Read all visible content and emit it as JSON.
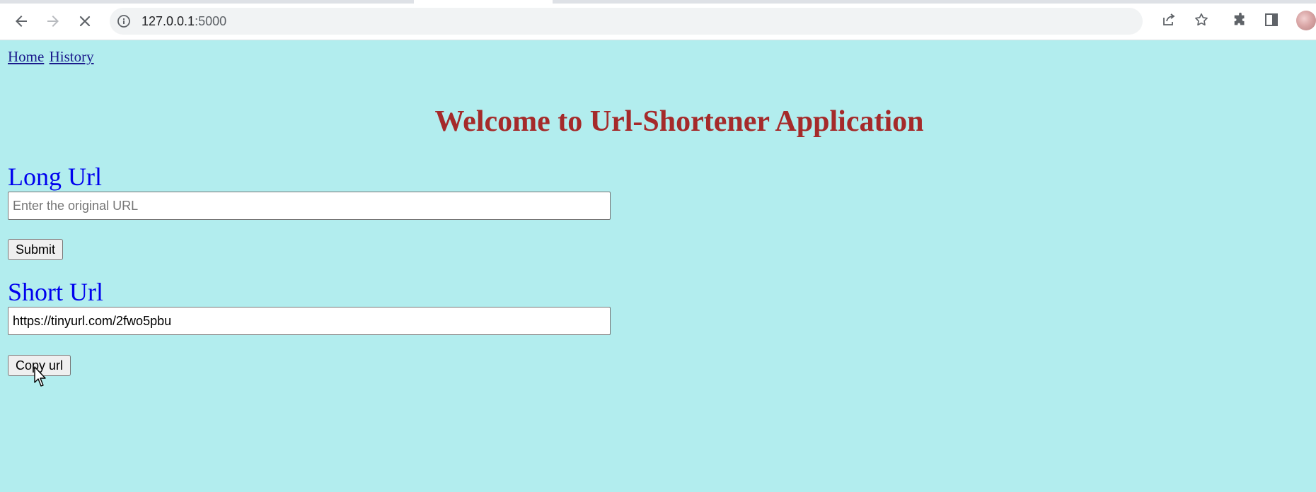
{
  "browser": {
    "url_host": "127.0.0.1",
    "url_port": ":5000"
  },
  "nav": {
    "home": "Home",
    "history": "History"
  },
  "heading": "Welcome to Url-Shortener Application",
  "long_url": {
    "label": "Long Url",
    "placeholder": "Enter the original URL",
    "value": ""
  },
  "submit_label": "Submit",
  "short_url": {
    "label": "Short Url",
    "value": "https://tinyurl.com/2fwo5pbu"
  },
  "copy_label": "Copy url",
  "colors": {
    "background": "#b2edee",
    "heading": "#a52a2a",
    "label": "#0000ee",
    "link": "#1a1a8c"
  },
  "icons": [
    "back-arrow-icon",
    "forward-arrow-icon",
    "stop-loading-icon",
    "info-icon",
    "share-icon",
    "star-icon",
    "extensions-puzzle-icon",
    "side-panel-icon",
    "profile-avatar"
  ]
}
